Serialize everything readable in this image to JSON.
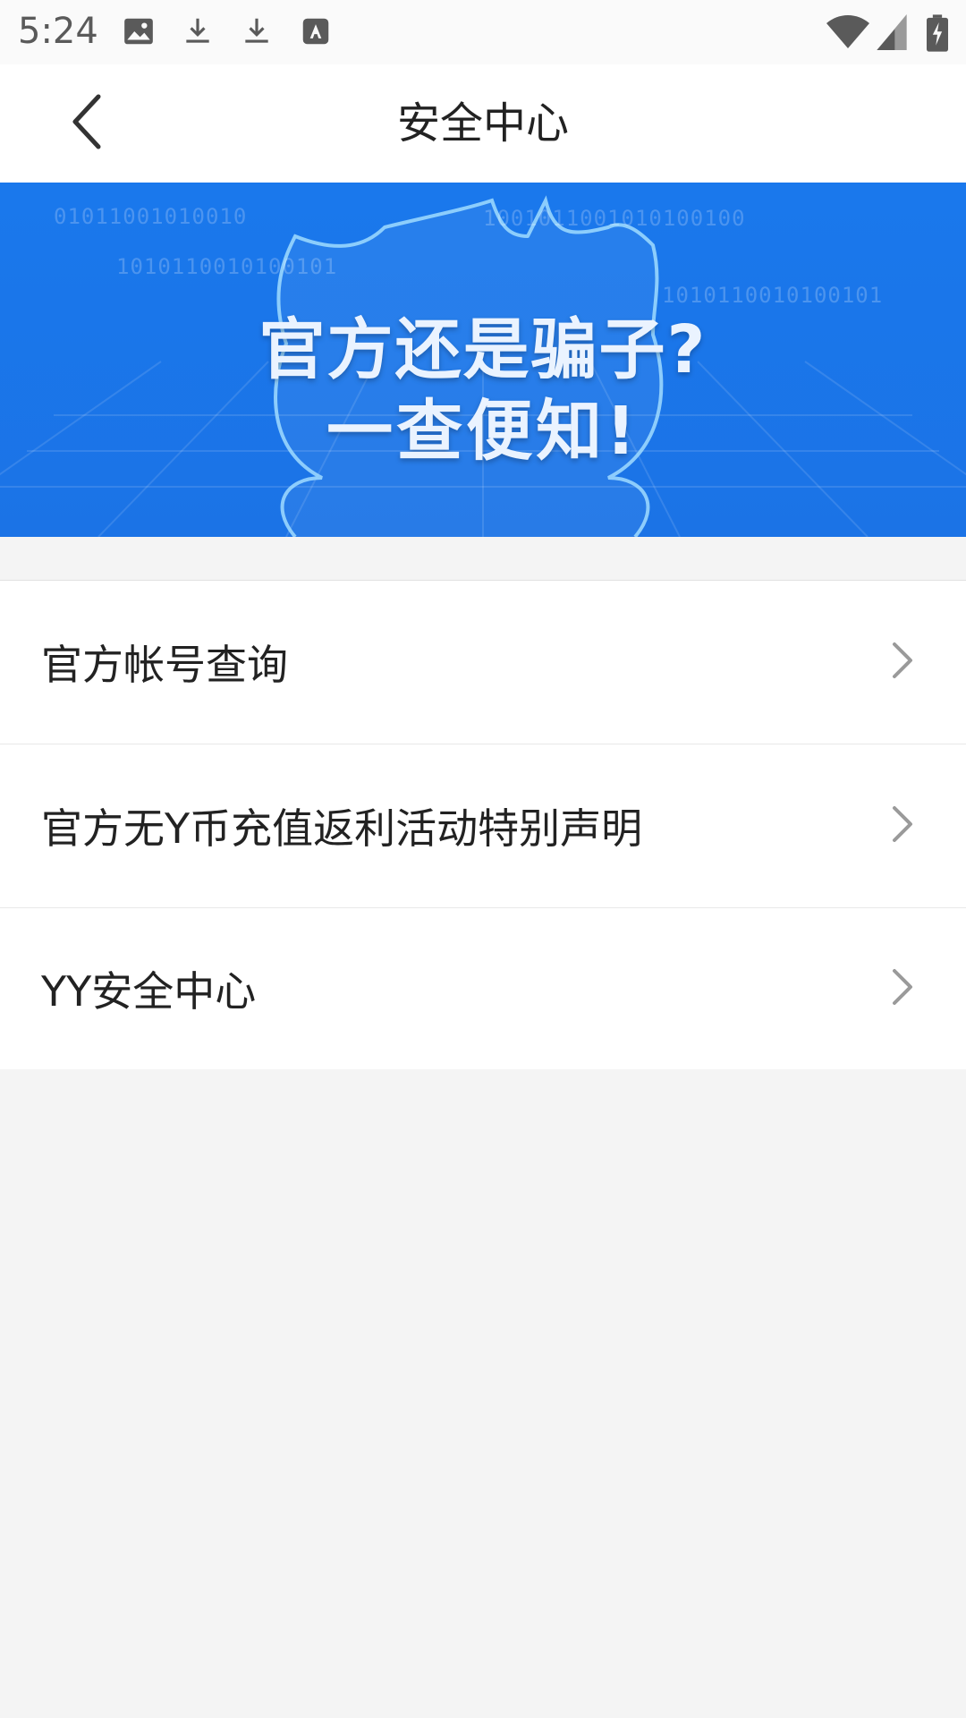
{
  "status_bar": {
    "time": "5:24",
    "icons": [
      "image-icon",
      "download-icon",
      "download-icon",
      "text-icon",
      "wifi-icon",
      "signal-icon",
      "battery-charging-icon"
    ]
  },
  "header": {
    "title": "安全中心",
    "back_icon": "chevron-left-icon"
  },
  "banner": {
    "line1": "官方还是骗子?",
    "line2": "一查便知!",
    "bits_1": "01011001010010",
    "bits_2": "1010110010100101",
    "bits_3": "1001011001010100100",
    "bits_4": "1010110010100101"
  },
  "menu": {
    "items": [
      {
        "label": "官方帐号查询"
      },
      {
        "label": "官方无Y币充值返利活动特别声明"
      },
      {
        "label": "YY安全中心"
      }
    ]
  },
  "colors": {
    "banner_blue": "#1a78ec",
    "background": "#f4f4f4"
  }
}
